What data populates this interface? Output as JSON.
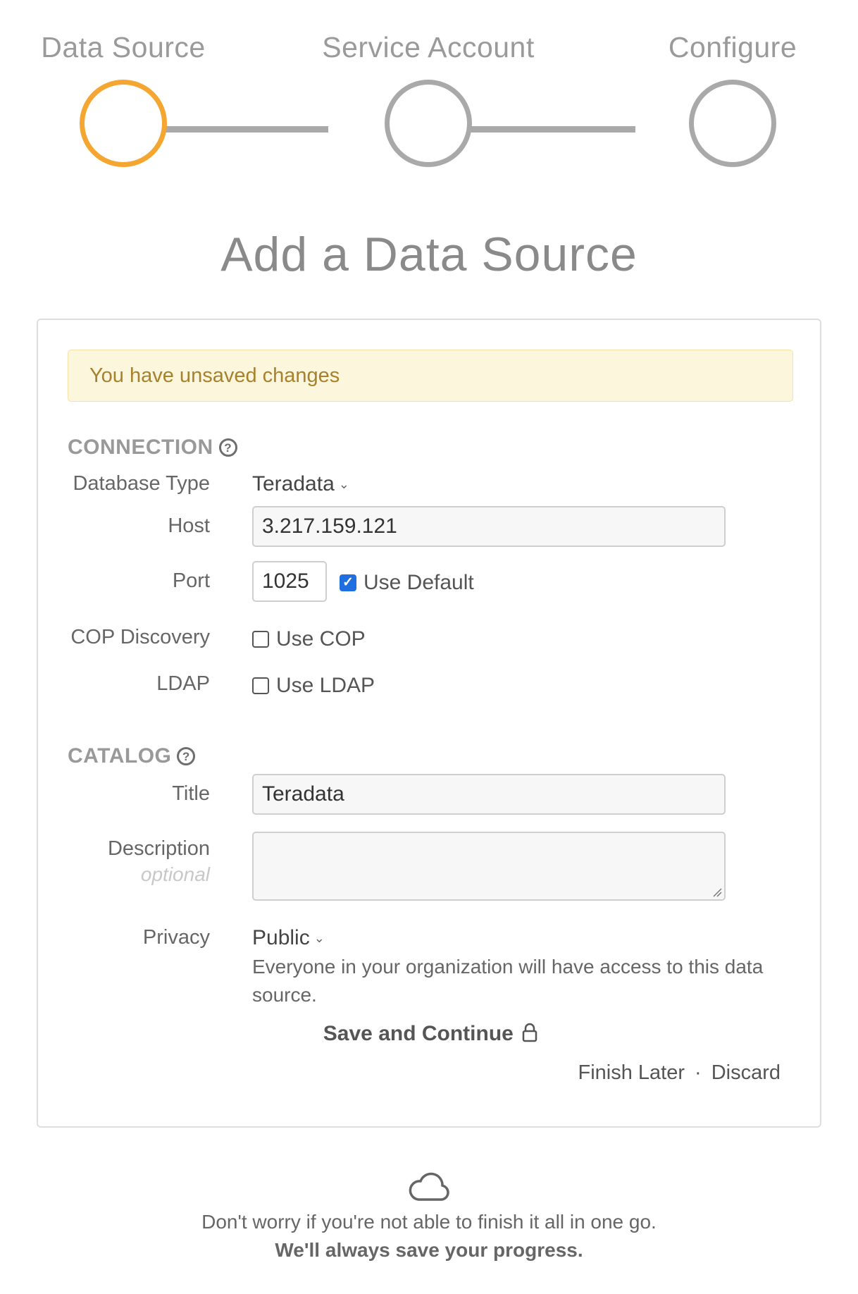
{
  "stepper": {
    "steps": [
      {
        "label": "Data Source",
        "active": true
      },
      {
        "label": "Service Account",
        "active": false
      },
      {
        "label": "Configure",
        "active": false
      }
    ],
    "active_color": "#f5a631",
    "inactive_color": "#a9a9a9"
  },
  "page_title": "Add a Data Source",
  "alert": {
    "message": "You have unsaved changes"
  },
  "connection": {
    "heading": "CONNECTION",
    "help_icon": "question-circle-icon",
    "database_type": {
      "label": "Database Type",
      "value": "Teradata"
    },
    "host": {
      "label": "Host",
      "value": "3.217.159.121"
    },
    "port": {
      "label": "Port",
      "value": "1025",
      "use_default_label": "Use Default",
      "use_default_checked": true
    },
    "cop_discovery": {
      "label": "COP Discovery",
      "checkbox_label": "Use COP",
      "checked": false
    },
    "ldap": {
      "label": "LDAP",
      "checkbox_label": "Use LDAP",
      "checked": false
    }
  },
  "catalog": {
    "heading": "CATALOG",
    "help_icon": "question-circle-icon",
    "title": {
      "label": "Title",
      "value": "Teradata"
    },
    "description": {
      "label": "Description",
      "sublabel": "optional",
      "value": ""
    },
    "privacy": {
      "label": "Privacy",
      "value": "Public",
      "note": "Everyone in your organization will have access to this data source."
    }
  },
  "actions": {
    "save_label": "Save and Continue",
    "save_icon": "lock-icon",
    "finish_later": "Finish Later",
    "separator": "·",
    "discard": "Discard"
  },
  "footer": {
    "icon": "cloud-icon",
    "line1": "Don't worry if you're not able to finish it all in one go.",
    "line2": "We'll always save your progress."
  }
}
